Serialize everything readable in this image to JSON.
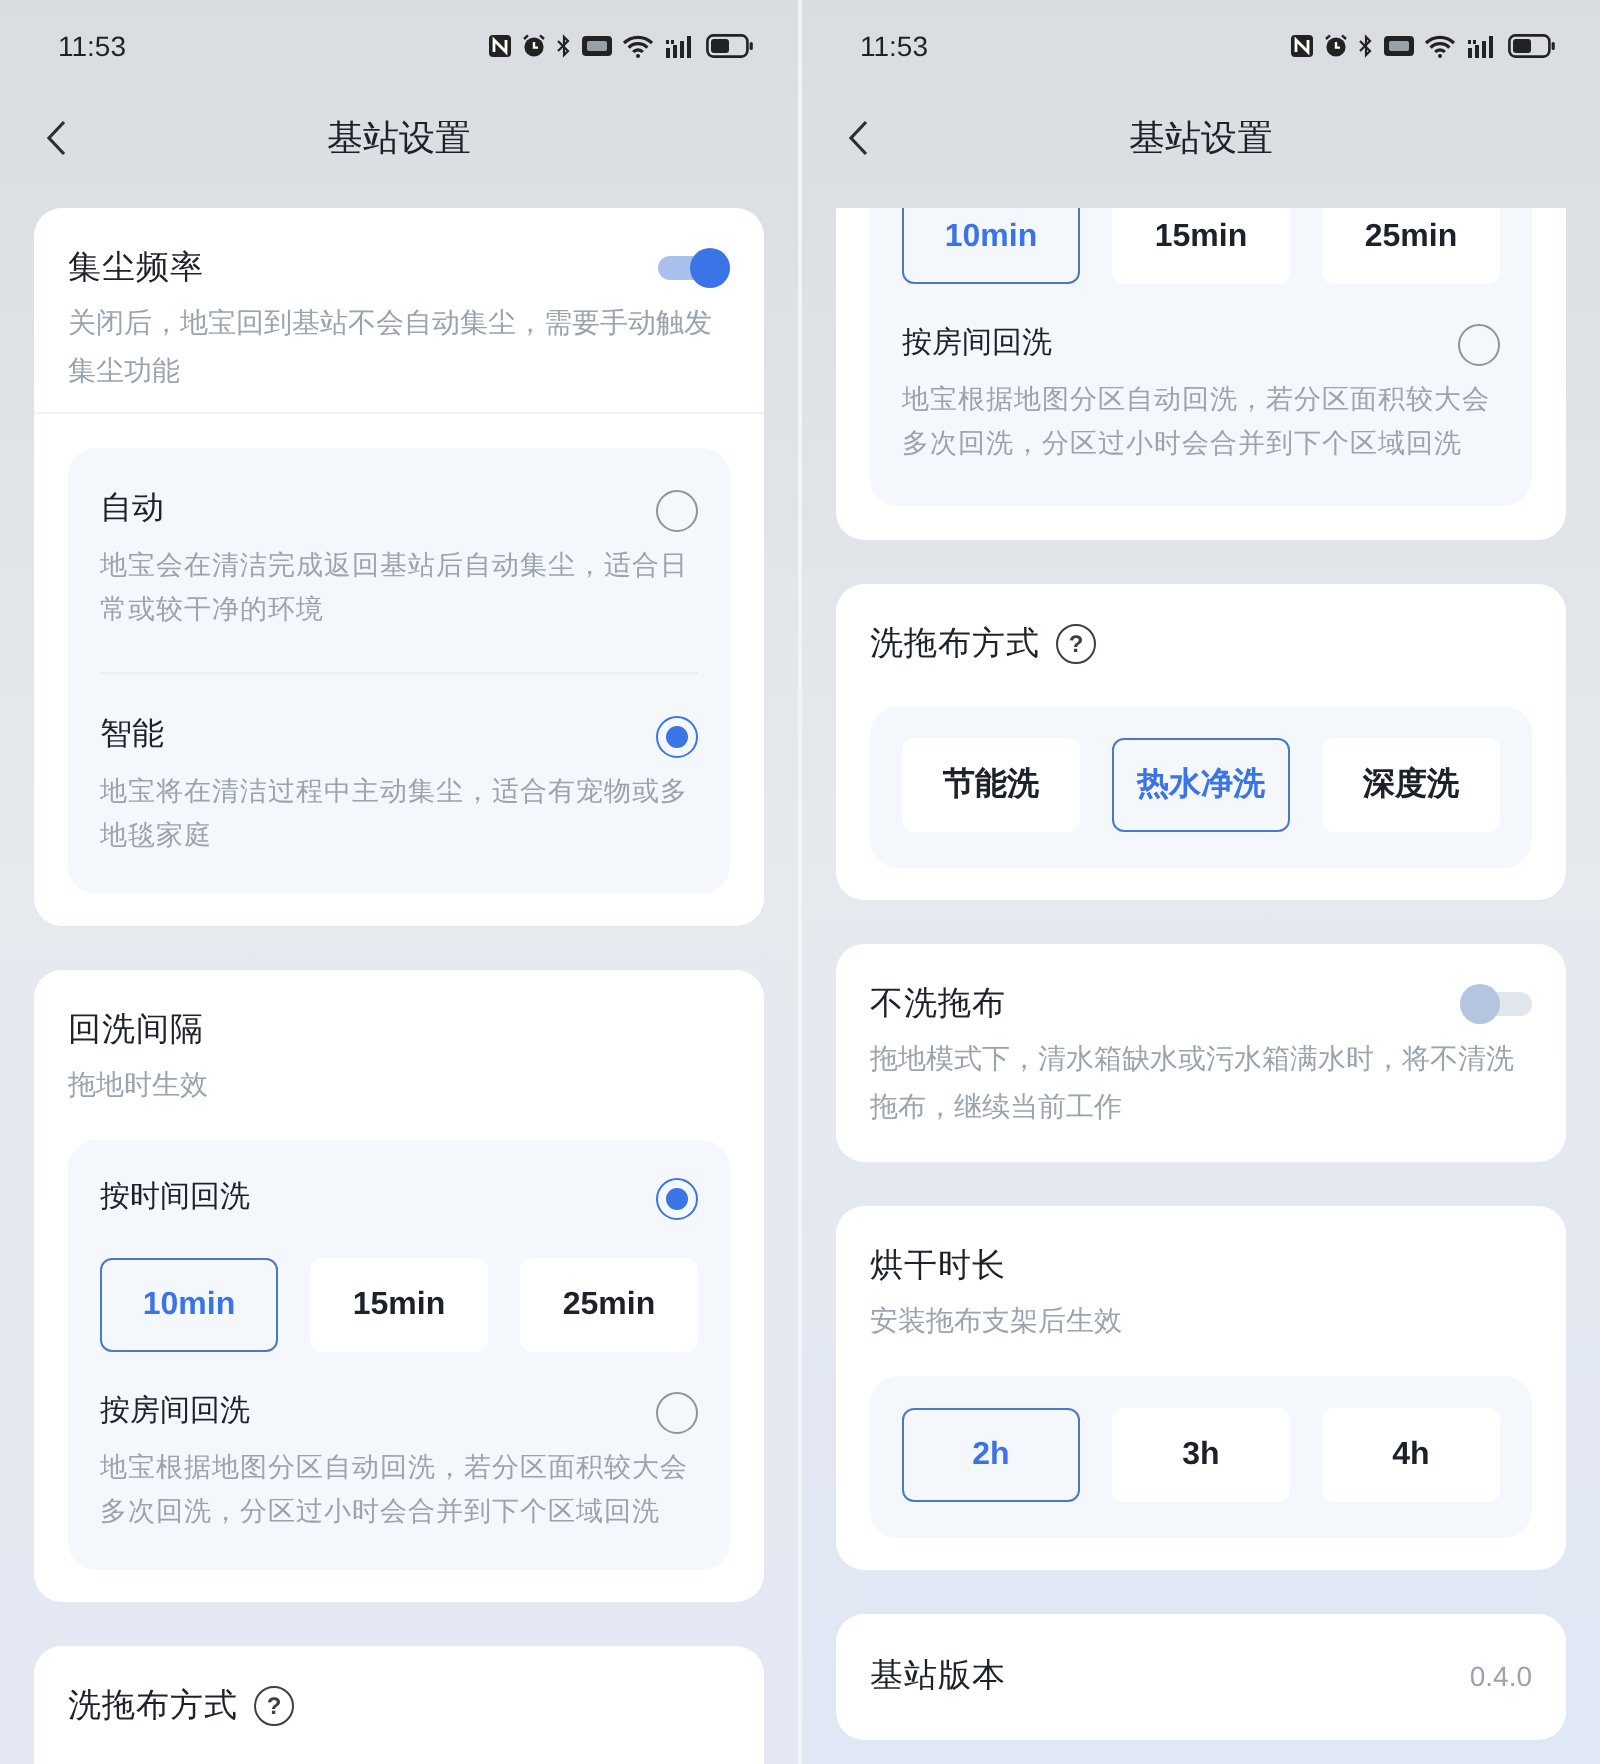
{
  "screens": [
    {
      "status_bar": {
        "time": "11:53"
      },
      "header": {
        "title": "基站设置"
      },
      "sections": [
        {
          "kind": "card",
          "title": "集尘频率",
          "toggle_on": true,
          "description": "关闭后，地宝回到基站不会自动集尘，需要手动触发集尘功能",
          "panel": [
            {
              "kind": "radio",
              "label": "自动",
              "selected": false,
              "description": "地宝会在清洁完成返回基站后自动集尘，适合日常或较干净的环境"
            },
            {
              "kind": "radio",
              "label": "智能",
              "selected": true,
              "description": "地宝将在清洁过程中主动集尘，适合有宠物或多地毯家庭"
            }
          ]
        },
        {
          "kind": "card",
          "title": "回洗间隔",
          "description": "拖地时生效",
          "panel": [
            {
              "kind": "radio",
              "label": "按时间回洗",
              "selected": true
            },
            {
              "kind": "options",
              "options": [
                {
                  "label": "10min",
                  "selected": true
                },
                {
                  "label": "15min",
                  "selected": false
                },
                {
                  "label": "25min",
                  "selected": false
                }
              ]
            },
            {
              "kind": "radio",
              "label": "按房间回洗",
              "selected": false,
              "description": "地宝根据地图分区自动回洗，若分区面积较大会多次回洗，分区过小时会合并到下个区域回洗"
            }
          ]
        },
        {
          "kind": "card",
          "title": "洗拖布方式",
          "help": "?"
        }
      ]
    },
    {
      "status_bar": {
        "time": "11:53"
      },
      "header": {
        "title": "基站设置"
      },
      "sections": [
        {
          "kind": "continued",
          "panel": [
            {
              "kind": "options",
              "options": [
                {
                  "label": "10min",
                  "selected": true
                },
                {
                  "label": "15min",
                  "selected": false
                },
                {
                  "label": "25min",
                  "selected": false
                }
              ]
            },
            {
              "kind": "radio",
              "label": "按房间回洗",
              "selected": false,
              "description": "地宝根据地图分区自动回洗，若分区面积较大会多次回洗，分区过小时会合并到下个区域回洗"
            }
          ]
        },
        {
          "kind": "card",
          "title": "洗拖布方式",
          "help": "?",
          "panel": [
            {
              "kind": "options",
              "options": [
                {
                  "label": "节能洗",
                  "selected": false
                },
                {
                  "label": "热水净洗",
                  "selected": true
                },
                {
                  "label": "深度洗",
                  "selected": false
                }
              ]
            }
          ]
        },
        {
          "kind": "card",
          "title": "不洗拖布",
          "toggle_on": false,
          "description": "拖地模式下，清水箱缺水或污水箱满水时，将不清洗拖布，继续当前工作"
        },
        {
          "kind": "card",
          "title": "烘干时长",
          "description": "安装拖布支架后生效",
          "panel": [
            {
              "kind": "options",
              "options": [
                {
                  "label": "2h",
                  "selected": true
                },
                {
                  "label": "3h",
                  "selected": false
                },
                {
                  "label": "4h",
                  "selected": false
                }
              ]
            }
          ]
        },
        {
          "kind": "card",
          "title": "基站版本",
          "value": "0.4.0"
        }
      ]
    }
  ]
}
